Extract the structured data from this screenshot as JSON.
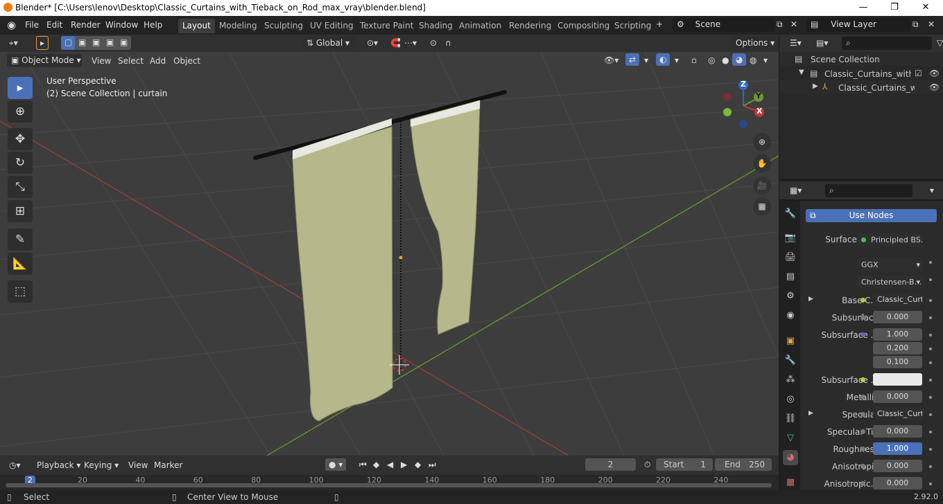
{
  "titlebar": {
    "title": "Blender* [C:\\Users\\lenov\\Desktop\\Classic_Curtains_with_Tieback_on_Rod_max_vray\\blender.blend]",
    "minimize": "—",
    "maximize": "❐",
    "close": "✕"
  },
  "menu": [
    "File",
    "Edit",
    "Render",
    "Window",
    "Help"
  ],
  "workspaces": [
    "Layout",
    "Modeling",
    "Sculpting",
    "UV Editing",
    "Texture Paint",
    "Shading",
    "Animation",
    "Rendering",
    "Compositing",
    "Scripting"
  ],
  "scene": {
    "name": "Scene",
    "view_layer": "View Layer"
  },
  "viewport_header": {
    "transform_orientation": "Global",
    "options": "Options",
    "mode": "Object Mode",
    "menus": [
      "View",
      "Select",
      "Add",
      "Object"
    ]
  },
  "viewport": {
    "perspective": "User Perspective",
    "collection_info": "(2) Scene Collection | curtain",
    "gizmo_axes": [
      "Z",
      "Y",
      "X"
    ]
  },
  "outliner": {
    "root": "Scene Collection",
    "items": [
      {
        "label": "Classic_Curtains_with_Ti"
      },
      {
        "label": "Classic_Curtains_wit"
      }
    ]
  },
  "properties": {
    "use_nodes": "Use Nodes",
    "surface_label": "Surface",
    "surface_value": "Principled BS...",
    "distribution": "GGX",
    "subsurface_method": "Christensen-B...",
    "rows": [
      {
        "label": "Base C...",
        "value": "Classic_Curta...",
        "kind": "dark",
        "dot": "#c7c729",
        "expand": true
      },
      {
        "label": "Subsurface",
        "value": "0.000",
        "kind": "num",
        "dot": "#7a7a7a"
      },
      {
        "label": "Subsurface ...",
        "value": "1.000",
        "kind": "num",
        "dot": "#6363c7"
      },
      {
        "label": "",
        "value": "0.200",
        "kind": "num"
      },
      {
        "label": "",
        "value": "0.100",
        "kind": "num"
      },
      {
        "label": "Subsurface ...",
        "value": "",
        "kind": "white",
        "dot": "#c7c729"
      },
      {
        "label": "Metallic",
        "value": "0.000",
        "kind": "num",
        "dot": "#7a7a7a"
      },
      {
        "label": "Specular",
        "value": "Classic_Curta...",
        "kind": "dark",
        "dot": "#7a7a7a",
        "expand": true
      },
      {
        "label": "Specular Tin",
        "value": "0.000",
        "kind": "num",
        "dot": "#7a7a7a"
      },
      {
        "label": "Roughness",
        "value": "1.000",
        "kind": "blue",
        "dot": "#7a7a7a"
      },
      {
        "label": "Anisotropic",
        "value": "0.000",
        "kind": "num",
        "dot": "#7a7a7a"
      },
      {
        "label": "Anisotropic...",
        "value": "0.000",
        "kind": "num",
        "dot": "#7a7a7a"
      }
    ]
  },
  "timeline": {
    "menus": [
      "Playback",
      "Keying",
      "View",
      "Marker"
    ],
    "current_frame": "2",
    "start_label": "Start",
    "start": "1",
    "end_label": "End",
    "end": "250",
    "ruler": [
      "2",
      "20",
      "40",
      "60",
      "80",
      "100",
      "120",
      "140",
      "160",
      "180",
      "200",
      "220",
      "240"
    ]
  },
  "statusbar": {
    "select": "Select",
    "center": "Center View to Mouse",
    "version": "2.92.0"
  },
  "colors": {
    "accent": "#4a71b8",
    "curtain": "#b5b88a",
    "x_axis": "#9d3b3b",
    "y_axis": "#6b9a2a",
    "z_axis": "#2f68c7"
  }
}
